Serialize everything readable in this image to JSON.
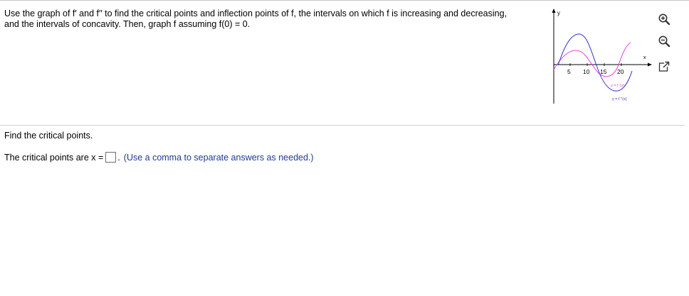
{
  "question": {
    "line1": "Use the graph of f′ and f′′ to find the critical points and inflection points of f, the intervals on which f is increasing and decreasing,",
    "line2": "and the intervals of concavity. Then, graph f assuming f(0) = 0."
  },
  "graph": {
    "y_axis_label": "y",
    "x_axis_label": "x",
    "tick_labels": [
      "5",
      "10",
      "15",
      "20"
    ],
    "curve_f_prime_label": "y = f ′(x)",
    "curve_f_double_prime_label": "y = f ′′(x)",
    "f_prime_color": "#e640e6",
    "f_double_prime_color": "#3333cc"
  },
  "tools": {
    "zoom_in_icon": "zoom-in-icon",
    "zoom_out_icon": "zoom-out-icon",
    "popout_icon": "external-window-icon"
  },
  "part": {
    "title": "Find the critical points.",
    "prompt": "The critical points are x =",
    "period": ".",
    "hint": "(Use a comma to separate answers as needed.)"
  }
}
